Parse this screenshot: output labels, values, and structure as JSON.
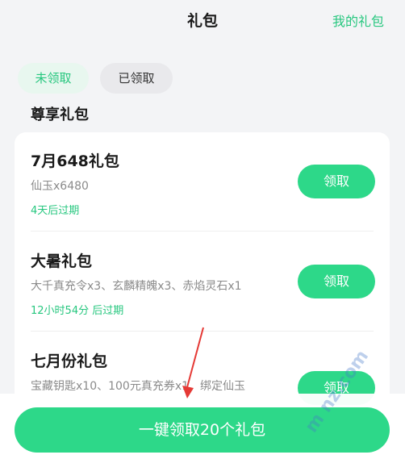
{
  "header": {
    "title": "礼包",
    "my_gifts_label": "我的礼包"
  },
  "tabs": [
    {
      "label": "未领取",
      "active": true
    },
    {
      "label": "已领取",
      "active": false
    }
  ],
  "section_title": "尊享礼包",
  "gifts": [
    {
      "name": "7月648礼包",
      "contents": "仙玉x6480",
      "expiry": "4天后过期",
      "button_label": "领取"
    },
    {
      "name": "大暑礼包",
      "contents": "大千真充令x3、玄麟精魄x3、赤焰灵石x1",
      "expiry": "12小时54分 后过期",
      "button_label": "领取"
    },
    {
      "name": "七月份礼包",
      "contents": "宝藏钥匙x10、100元真充券x1、绑定仙玉",
      "expiry": "",
      "button_label": "领取"
    }
  ],
  "claim_all_label": "一键领取20个礼包",
  "watermark": "m...nz.com",
  "colors": {
    "accent": "#2dd889",
    "accent_text": "#27c77f",
    "arrow": "#e53935"
  }
}
